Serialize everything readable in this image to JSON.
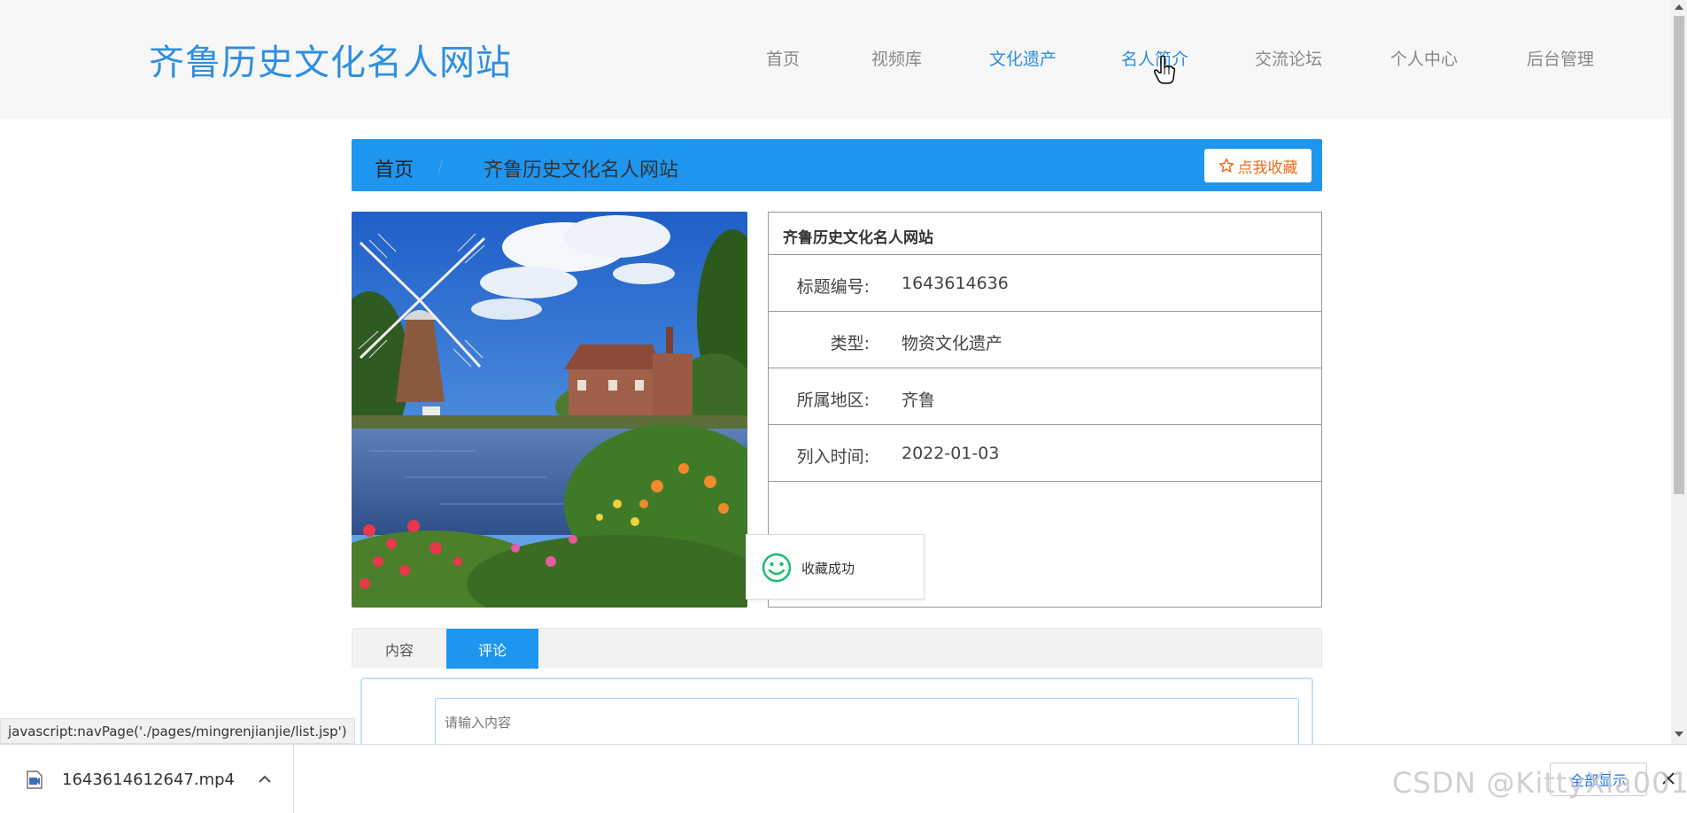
{
  "header": {
    "site_title": "齐鲁历史文化名人网站",
    "nav": [
      "首页",
      "视频库",
      "文化遗产",
      "名人简介",
      "交流论坛",
      "个人中心",
      "后台管理"
    ],
    "active_nav_index": 2,
    "hover_nav_index": 3
  },
  "breadcrumb": {
    "home": "首页",
    "separator": "/",
    "current": "齐鲁历史文化名人网站",
    "favorite_button": "点我收藏"
  },
  "detail": {
    "title": "齐鲁历史文化名人网站",
    "rows": [
      {
        "label": "标题编号:",
        "value": "1643614636"
      },
      {
        "label": "类型:",
        "value": "物资文化遗产"
      },
      {
        "label": "所属地区:",
        "value": "齐鲁"
      },
      {
        "label": "列入时间:",
        "value": "2022-01-03"
      }
    ]
  },
  "toast": {
    "message": "收藏成功"
  },
  "tabs": {
    "items": [
      "内容",
      "评论"
    ],
    "active_index": 1,
    "comment_placeholder": "请输入内容"
  },
  "status_url": "javascript:navPage('./pages/mingrenjianjie/list.jsp')",
  "download_bar": {
    "file_name": "1643614612647.mp4",
    "show_all": "全部显示"
  },
  "watermark": "CSDN @KittyXia001",
  "colors": {
    "brand_blue": "#1e96f0",
    "title_blue": "#2f8fe0",
    "favorite_orange": "#f26c1c",
    "toast_green": "#19be6b"
  }
}
